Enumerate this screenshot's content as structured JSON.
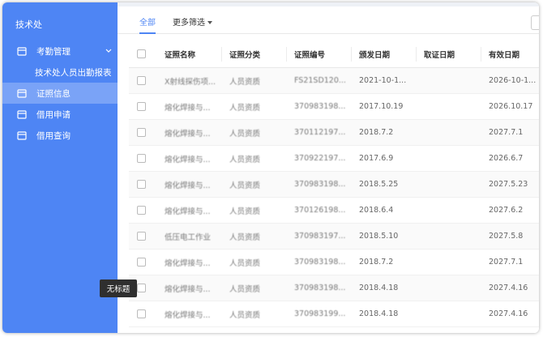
{
  "sidebar": {
    "title": "技术处",
    "items": [
      {
        "label": "考勤管理",
        "icon": "folder-icon"
      },
      {
        "label": "技术处人员出勤报表"
      },
      {
        "label": "证照信息",
        "icon": "folder-icon"
      },
      {
        "label": "借用申请",
        "icon": "folder-icon"
      },
      {
        "label": "借用查询",
        "icon": "folder-icon"
      }
    ]
  },
  "tabs": {
    "all": "全部",
    "more_filters": "更多筛选"
  },
  "table": {
    "headers": [
      "证照名称",
      "证照分类",
      "证照编号",
      "颁发日期",
      "取证日期",
      "有效日期"
    ],
    "rows": [
      [
        "X射线探伤项...",
        "人员资质",
        "FS21SD120...",
        "2021-10-1...",
        "",
        "2026-10-1..."
      ],
      [
        "熔化焊接与...",
        "人员资质",
        "370983198...",
        "2017.10.19",
        "",
        "2026.10.17"
      ],
      [
        "熔化焊接与...",
        "人员资质",
        "370112197...",
        "2018.7.2",
        "",
        "2027.7.1"
      ],
      [
        "熔化焊接与...",
        "人员资质",
        "370922197...",
        "2017.6.9",
        "",
        "2026.6.7"
      ],
      [
        "熔化焊接与...",
        "人员资质",
        "370983198...",
        "2018.5.25",
        "",
        "2027.5.23"
      ],
      [
        "熔化焊接与...",
        "人员资质",
        "370126198...",
        "2018.6.4",
        "",
        "2027.6.2"
      ],
      [
        "低压电工作业",
        "人员资质",
        "370983197...",
        "2018.5.10",
        "",
        "2027.5.8"
      ],
      [
        "熔化焊接与...",
        "人员资质",
        "370983198...",
        "2018.7.2",
        "",
        "2027.7.1"
      ],
      [
        "熔化焊接与...",
        "人员资质",
        "370983198...",
        "2018.4.18",
        "",
        "2027.4.16"
      ],
      [
        "熔化焊接与...",
        "人员资质",
        "370983199...",
        "2018.4.18",
        "",
        "2027.4.16"
      ]
    ]
  },
  "tooltip": "无标题",
  "colors": {
    "sidebar_bg": "#4e85f4",
    "sidebar_active": "#7aa3f7",
    "accent": "#4e85f4"
  }
}
